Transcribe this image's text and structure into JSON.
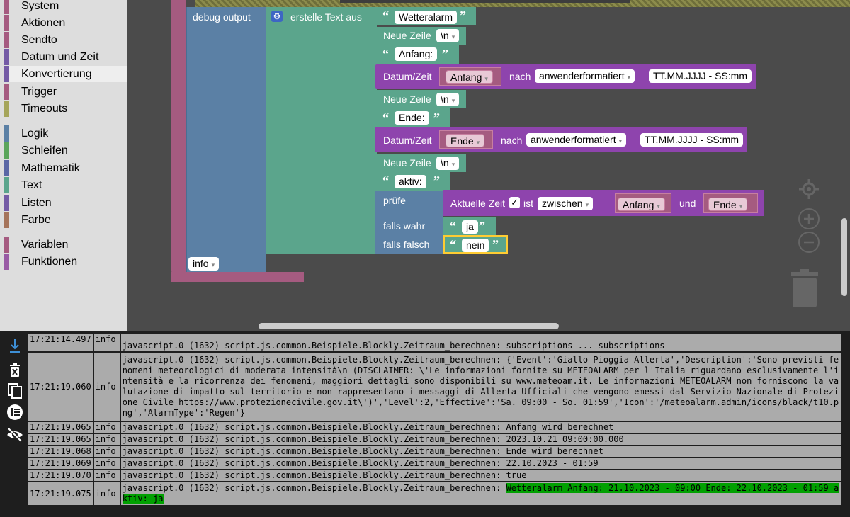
{
  "toolbox": {
    "items": [
      {
        "label": "System",
        "color": "#a55b80"
      },
      {
        "label": "Aktionen",
        "color": "#a55b80"
      },
      {
        "label": "Sendto",
        "color": "#a55b80"
      },
      {
        "label": "Datum und Zeit",
        "color": "#745ba5"
      },
      {
        "label": "Konvertierung",
        "color": "#745ba5"
      },
      {
        "label": "Trigger",
        "color": "#a55b80"
      },
      {
        "label": "Timeouts",
        "color": "#a5a55b"
      },
      {
        "label": "Logik",
        "color": "#5b80a5"
      },
      {
        "label": "Schleifen",
        "color": "#5ba55b"
      },
      {
        "label": "Mathematik",
        "color": "#5b67a5"
      },
      {
        "label": "Text",
        "color": "#5ba58c"
      },
      {
        "label": "Listen",
        "color": "#745ba5"
      },
      {
        "label": "Farbe",
        "color": "#a5745b"
      },
      {
        "label": "Variablen",
        "color": "#a55b80"
      },
      {
        "label": "Funktionen",
        "color": "#995ba5"
      }
    ]
  },
  "blocks": {
    "debug_label": "debug output",
    "text_join_label": "erstelle Text aus",
    "str1": "Wetteralarm",
    "newline_label": "Neue Zeile",
    "newline_val": "\\n",
    "str_anfang": "Anfang:",
    "datum_label": "Datum/Zeit",
    "var_anfang": "Anfang",
    "nach_label": "nach",
    "format_dd": "anwenderformatiert",
    "format_str": "TT.MM.JJJJ - SS:mm",
    "str_ende": "Ende:",
    "var_ende": "Ende",
    "str_aktiv": "aktiv:",
    "pruefe_label": "prüfe",
    "aktuelle_zeit_label": "Aktuelle Zeit",
    "ist_label": "ist",
    "zwischen_dd": "zwischen",
    "und_label": "und",
    "falls_wahr": "falls wahr",
    "falls_falsch": "falls falsch",
    "str_ja": "ja",
    "str_nein": "nein",
    "info_dd": "info",
    "checkmark": "✓"
  },
  "log": {
    "rows": [
      {
        "time": "17:21:14.497",
        "sev": "info",
        "msg": "javascript.0 (1632) script.js.common.Beispiele.Blockly.Zeitraum_berechnen: subscriptions ... subscriptions",
        "partial": true
      },
      {
        "time": "17:21:19.060",
        "sev": "info",
        "msg": "javascript.0 (1632) script.js.common.Beispiele.Blockly.Zeitraum_berechnen: {'Event':'Giallo Pioggia Allerta','Description':'Sono previsti fenomeni meteorologici di moderata intensità\\n (DISCLAIMER: \\'Le informazioni fornite su METEOALARM per l'Italia riguardano esclusivamente l'intensità e la ricorrenza dei fenomeni, maggiori dettagli sono disponibili su www.meteoam.it. Le informazioni METEOALARM non forniscono la valutazione di impatto sul territorio e non rappresentano i messaggi di Allerta Ufficiali che vengono emessi dal Servizio Nazionale di Protezione Civile https://www.protezionecivile.gov.it\\')','Level':2,'Effective':'Sa. 09:00 - So. 01:59','Icon':'/meteoalarm.admin/icons/black/t10.png','AlarmType':'Regen'}"
      },
      {
        "time": "17:21:19.065",
        "sev": "info",
        "msg": "javascript.0 (1632) script.js.common.Beispiele.Blockly.Zeitraum_berechnen: Anfang wird berechnet"
      },
      {
        "time": "17:21:19.065",
        "sev": "info",
        "msg": "javascript.0 (1632) script.js.common.Beispiele.Blockly.Zeitraum_berechnen: 2023.10.21 09:00:00.000"
      },
      {
        "time": "17:21:19.068",
        "sev": "info",
        "msg": "javascript.0 (1632) script.js.common.Beispiele.Blockly.Zeitraum_berechnen: Ende wird berechnet"
      },
      {
        "time": "17:21:19.069",
        "sev": "info",
        "msg": "javascript.0 (1632) script.js.common.Beispiele.Blockly.Zeitraum_berechnen: 22.10.2023 - 01:59"
      },
      {
        "time": "17:21:19.070",
        "sev": "info",
        "msg": "javascript.0 (1632) script.js.common.Beispiele.Blockly.Zeitraum_berechnen: true"
      },
      {
        "time": "17:21:19.075",
        "sev": "info",
        "msg_prefix": "javascript.0 (1632) script.js.common.Beispiele.Blockly.Zeitraum_berechnen: ",
        "msg_hl": "Wetteralarm Anfang: 21.10.2023 - 09:00 Ende: 22.10.2023 - 01:59 aktiv: ja"
      }
    ]
  },
  "colors": {
    "text_block": "#5ba58c",
    "date_block": "#8e44ad",
    "logic_block": "#5b80a5",
    "var_block": "#a55b80",
    "highlight": "#00a000"
  }
}
